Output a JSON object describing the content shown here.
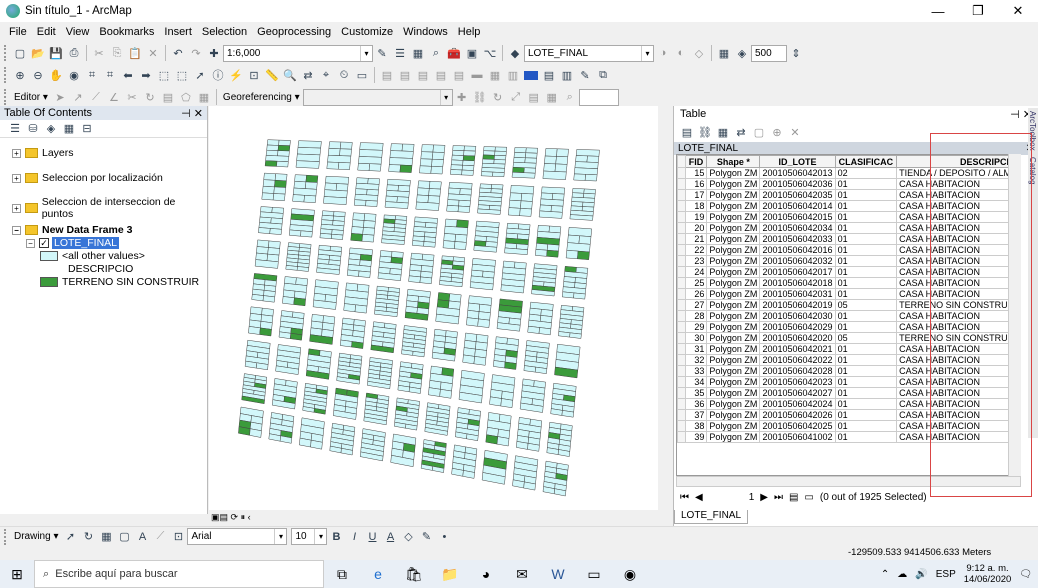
{
  "window": {
    "title": "Sin título_1 - ArcMap",
    "min": "—",
    "max": "❐",
    "close": "✕"
  },
  "menu": [
    "File",
    "Edit",
    "View",
    "Bookmarks",
    "Insert",
    "Selection",
    "Geoprocessing",
    "Customize",
    "Windows",
    "Help"
  ],
  "toolbar": {
    "scale": "1:6,000",
    "layer_combo": "LOTE_FINAL",
    "size_combo": "500",
    "editor": "Editor ▾",
    "georef": "Georeferencing ▾"
  },
  "toc": {
    "title": "Table Of Contents",
    "pin": "⊣ ✕",
    "layers": [
      "Layers",
      "Seleccion por localización",
      "Seleccion de interseccion de puntos"
    ],
    "frame": "New Data Frame 3",
    "layer": "LOTE_FINAL",
    "legend": {
      "other": "<all other values>",
      "heading": "DESCRIPCIO",
      "item": "TERRENO SIN CONSTRUIR"
    }
  },
  "colors": {
    "parcel_fill": "#d2f7fa",
    "terreno_fill": "#3b9b3b",
    "selection": "#3875d7",
    "highlight": "#d94545"
  },
  "table": {
    "pane_title": "Table",
    "pane_pin": "⊣ ✕",
    "title": "LOTE_FINAL",
    "close": "✕",
    "columns": [
      "FID",
      "Shape *",
      "ID_LOTE",
      "CLASIFICAC",
      "DESCRIPCIO"
    ],
    "rows": [
      [
        "15",
        "Polygon ZM",
        "20010506042013",
        "02",
        "TIENDA / DEPOSITO / ALMA"
      ],
      [
        "16",
        "Polygon ZM",
        "20010506042036",
        "01",
        "CASA HABITACION"
      ],
      [
        "17",
        "Polygon ZM",
        "20010506042035",
        "01",
        "CASA HABITACION"
      ],
      [
        "18",
        "Polygon ZM",
        "20010506042014",
        "01",
        "CASA HABITACION"
      ],
      [
        "19",
        "Polygon ZM",
        "20010506042015",
        "01",
        "CASA HABITACION"
      ],
      [
        "20",
        "Polygon ZM",
        "20010506042034",
        "01",
        "CASA HABITACION"
      ],
      [
        "21",
        "Polygon ZM",
        "20010506042033",
        "01",
        "CASA HABITACION"
      ],
      [
        "22",
        "Polygon ZM",
        "20010506042016",
        "01",
        "CASA HABITACION"
      ],
      [
        "23",
        "Polygon ZM",
        "20010506042032",
        "01",
        "CASA HABITACION"
      ],
      [
        "24",
        "Polygon ZM",
        "20010506042017",
        "01",
        "CASA HABITACION"
      ],
      [
        "25",
        "Polygon ZM",
        "20010506042018",
        "01",
        "CASA HABITACION"
      ],
      [
        "26",
        "Polygon ZM",
        "20010506042031",
        "01",
        "CASA HABITACION"
      ],
      [
        "27",
        "Polygon ZM",
        "20010506042019",
        "05",
        "TERRENO SIN CONSTRUIR"
      ],
      [
        "28",
        "Polygon ZM",
        "20010506042030",
        "01",
        "CASA HABITACION"
      ],
      [
        "29",
        "Polygon ZM",
        "20010506042029",
        "01",
        "CASA HABITACION"
      ],
      [
        "30",
        "Polygon ZM",
        "20010506042020",
        "05",
        "TERRENO SIN CONSTRUIR"
      ],
      [
        "31",
        "Polygon ZM",
        "20010506042021",
        "01",
        "CASA HABITACION"
      ],
      [
        "32",
        "Polygon ZM",
        "20010506042022",
        "01",
        "CASA HABITACION"
      ],
      [
        "33",
        "Polygon ZM",
        "20010506042028",
        "01",
        "CASA HABITACION"
      ],
      [
        "34",
        "Polygon ZM",
        "20010506042023",
        "01",
        "CASA HABITACION"
      ],
      [
        "35",
        "Polygon ZM",
        "20010506042027",
        "01",
        "CASA HABITACION"
      ],
      [
        "36",
        "Polygon ZM",
        "20010506042024",
        "01",
        "CASA HABITACION"
      ],
      [
        "37",
        "Polygon ZM",
        "20010506042026",
        "01",
        "CASA HABITACION"
      ],
      [
        "38",
        "Polygon ZM",
        "20010506042025",
        "01",
        "CASA HABITACION"
      ],
      [
        "39",
        "Polygon ZM",
        "20010506041002",
        "01",
        "CASA HABITACION"
      ]
    ],
    "record": "1",
    "selected": "(0 out of 1925 Selected)",
    "tab": "LOTE_FINAL"
  },
  "side_tabs": [
    "ArcToolbox",
    "Catalog"
  ],
  "drawing": {
    "label": "Drawing ▾",
    "font": "Arial",
    "size": "10",
    "bold": "B",
    "italic": "I",
    "underline": "U",
    "fontcolor": "A"
  },
  "status": {
    "coords": "-129509.533 9414506.633 Meters"
  },
  "taskbar": {
    "search": "Escribe aquí para buscar",
    "lang": "ESP",
    "time": "9:12 a. m.",
    "date": "14/06/2020"
  }
}
